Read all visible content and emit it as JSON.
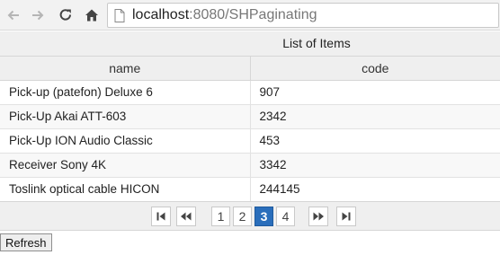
{
  "browser": {
    "url_host": "localhost",
    "url_rest": ":8080/SHPaginating",
    "icons": {
      "back": "arrow-left-icon",
      "forward": "arrow-right-icon",
      "reload": "reload-icon",
      "home": "home-icon",
      "page": "page-icon"
    }
  },
  "table": {
    "caption": "List of Items",
    "columns": [
      "name",
      "code"
    ],
    "rows": [
      {
        "name": "Pick-up (patefon) Deluxe 6",
        "code": "907"
      },
      {
        "name": "Pick-Up Akai ATT-603",
        "code": "2342"
      },
      {
        "name": "Pick-Up ION Audio Classic",
        "code": "453"
      },
      {
        "name": "Receiver Sony 4K",
        "code": "3342"
      },
      {
        "name": "Toslink optical cable HICON",
        "code": "244145"
      }
    ]
  },
  "paginator": {
    "pages": [
      "1",
      "2",
      "3",
      "4"
    ],
    "current_page": "3",
    "icons": {
      "first": "first-page-icon",
      "prev": "previous-page-icon",
      "next": "next-page-icon",
      "last": "last-page-icon"
    },
    "active_color": "#2a6ebb"
  },
  "actions": {
    "refresh_label": "Refresh"
  }
}
